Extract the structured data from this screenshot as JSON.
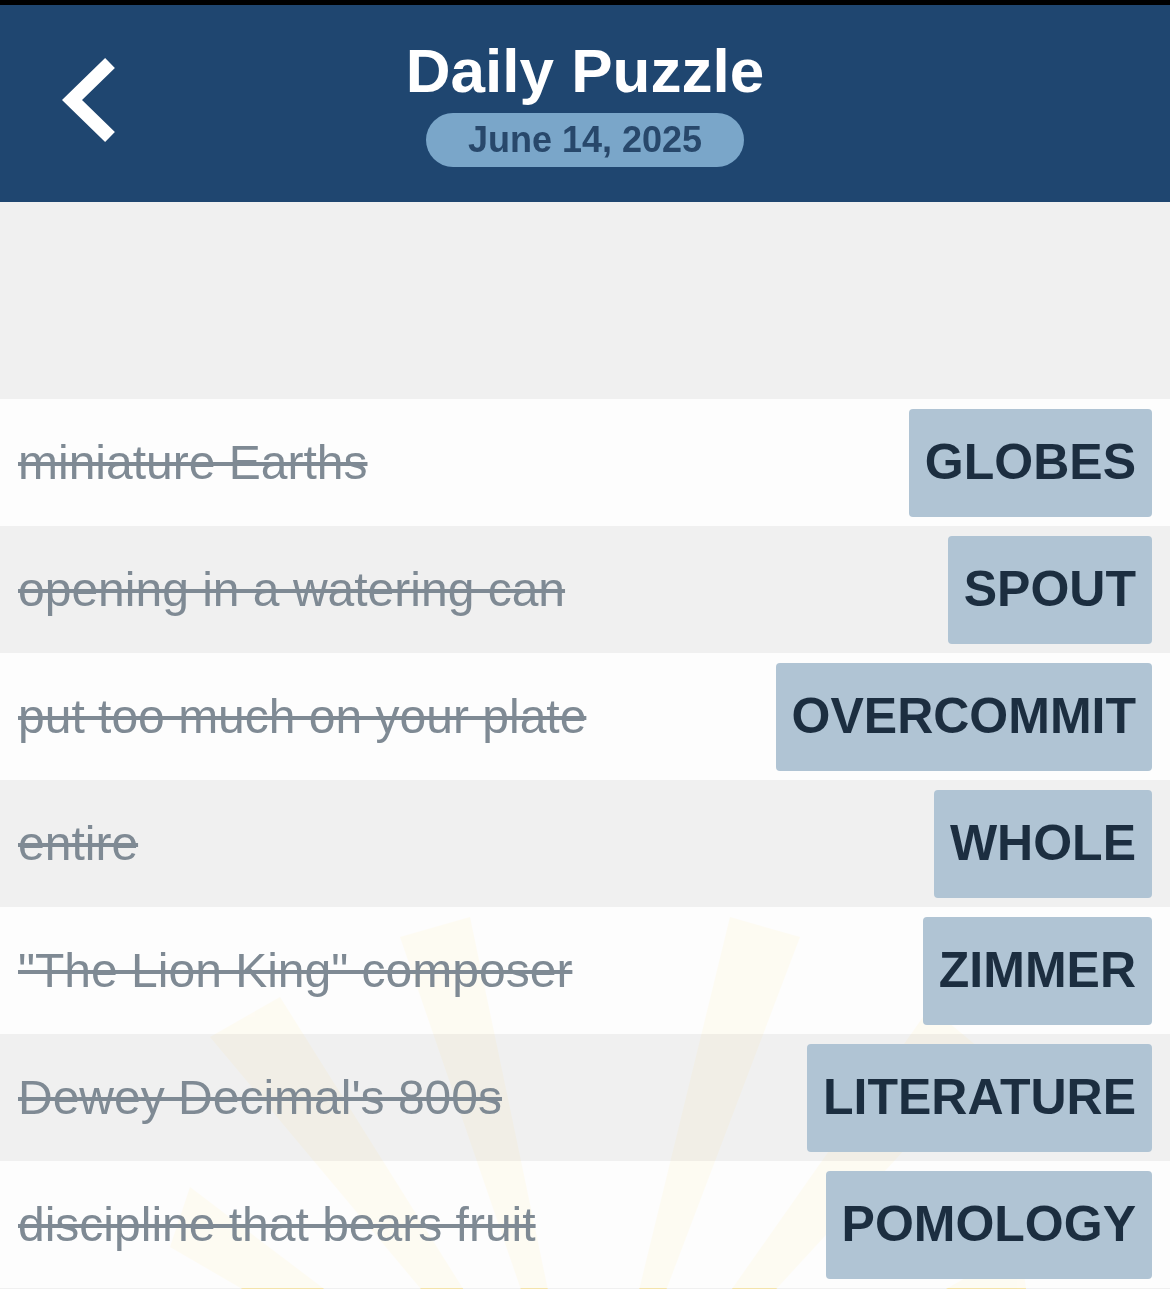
{
  "header": {
    "title": "Daily Puzzle",
    "date": "June 14, 2025"
  },
  "clues": [
    {
      "clue": "miniature Earths",
      "answer": "GLOBES",
      "solved": true
    },
    {
      "clue": "opening in a watering can",
      "answer": "SPOUT",
      "solved": true
    },
    {
      "clue": "put too much on your plate",
      "answer": "OVERCOMMIT",
      "solved": true
    },
    {
      "clue": "entire",
      "answer": "WHOLE",
      "solved": true
    },
    {
      "clue": "\"The Lion King\" composer",
      "answer": "ZIMMER",
      "solved": true
    },
    {
      "clue": "Dewey Decimal's 800s",
      "answer": "LITERATURE",
      "solved": true
    },
    {
      "clue": "discipline that bears fruit",
      "answer": "POMOLOGY",
      "solved": true
    }
  ]
}
